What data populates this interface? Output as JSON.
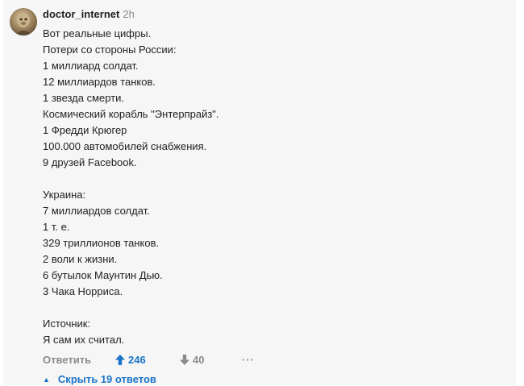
{
  "comment": {
    "username": "doctor_internet",
    "time": "2h",
    "lines": [
      "Вот реальные цифры.",
      "Потери со стороны России:",
      "1 миллиард солдат.",
      "12 миллиардов танков.",
      "1 звезда смерти.",
      "Космический корабль \"Энтерпрайз\".",
      "1 Фредди Крюгер",
      "100.000 автомобилей снабжения.",
      "9 друзей Facebook.",
      "",
      "Украина:",
      "7 миллиардов солдат.",
      "1 т. е.",
      "329 триллионов танков.",
      "2 воли к жизни.",
      "6 бутылок Маунтин Дью.",
      "3 Чака Норриса.",
      "",
      "Источник:",
      "Я сам их считал."
    ]
  },
  "actions": {
    "reply_label": "Ответить",
    "upvotes": "246",
    "downvotes": "40",
    "more_label": "···",
    "upvote_color": "#1a73c8",
    "muted_color": "#8a8a8a"
  },
  "replies": {
    "hide_label": "Скрыть 19 ответов",
    "icon": "caret-up-icon"
  },
  "icons": {
    "avatar": "user-avatar",
    "upvote": "arrow-up-icon",
    "downvote": "arrow-down-icon",
    "more": "more-icon"
  }
}
